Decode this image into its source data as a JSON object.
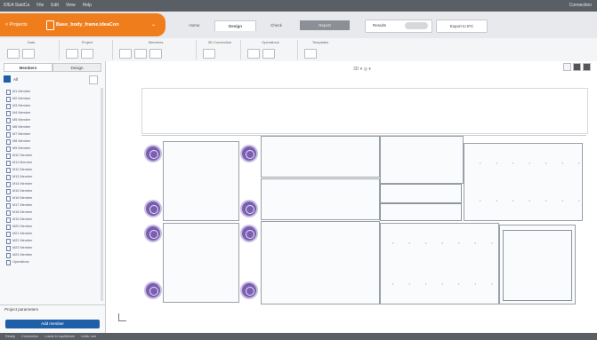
{
  "titlebar": {
    "menus": [
      "IDEA StatiCa",
      "File",
      "Edit",
      "View",
      "Help"
    ],
    "right": "Connection"
  },
  "header": {
    "back_label": "< Projects",
    "file_name": "Base_body_frame.ideaCon",
    "ribbon_tabs": [
      "Home",
      "Design",
      "Check",
      "Report",
      "Export"
    ],
    "toggle_label": "Results",
    "export_label": "Export to IFC"
  },
  "ribbon": {
    "groups": [
      "Data",
      "Project",
      "Members",
      "3D Connection",
      "Operations",
      "Templates"
    ]
  },
  "left_panel": {
    "tabs": [
      "Members",
      "Design"
    ],
    "root_label": "All",
    "items": [
      "M1 Member",
      "M2 Member",
      "M3 Member",
      "M4 Member",
      "M5 Member",
      "M6 Member",
      "M7 Member",
      "M8 Member",
      "M9 Member",
      "M10 Member",
      "M11 Member",
      "M12 Member",
      "M13 Member",
      "M14 Member",
      "M15 Member",
      "M16 Member",
      "M17 Member",
      "M18 Member",
      "M19 Member",
      "M20 Member",
      "M21 Member",
      "M22 Member",
      "M23 Member",
      "M24 Member",
      "Operations"
    ],
    "properties_label": "Project parameters",
    "add_button_label": "Add member"
  },
  "canvas": {
    "view_toolbar": "3D  ▾  ◎  ▾"
  },
  "status": {
    "items": [
      "Ready",
      "Connection",
      "Loads in equilibrium",
      "Units: mm"
    ]
  },
  "colors": {
    "accent": "#f07d1c",
    "primary": "#1f5fa8",
    "circle": "#7a5fb0"
  }
}
